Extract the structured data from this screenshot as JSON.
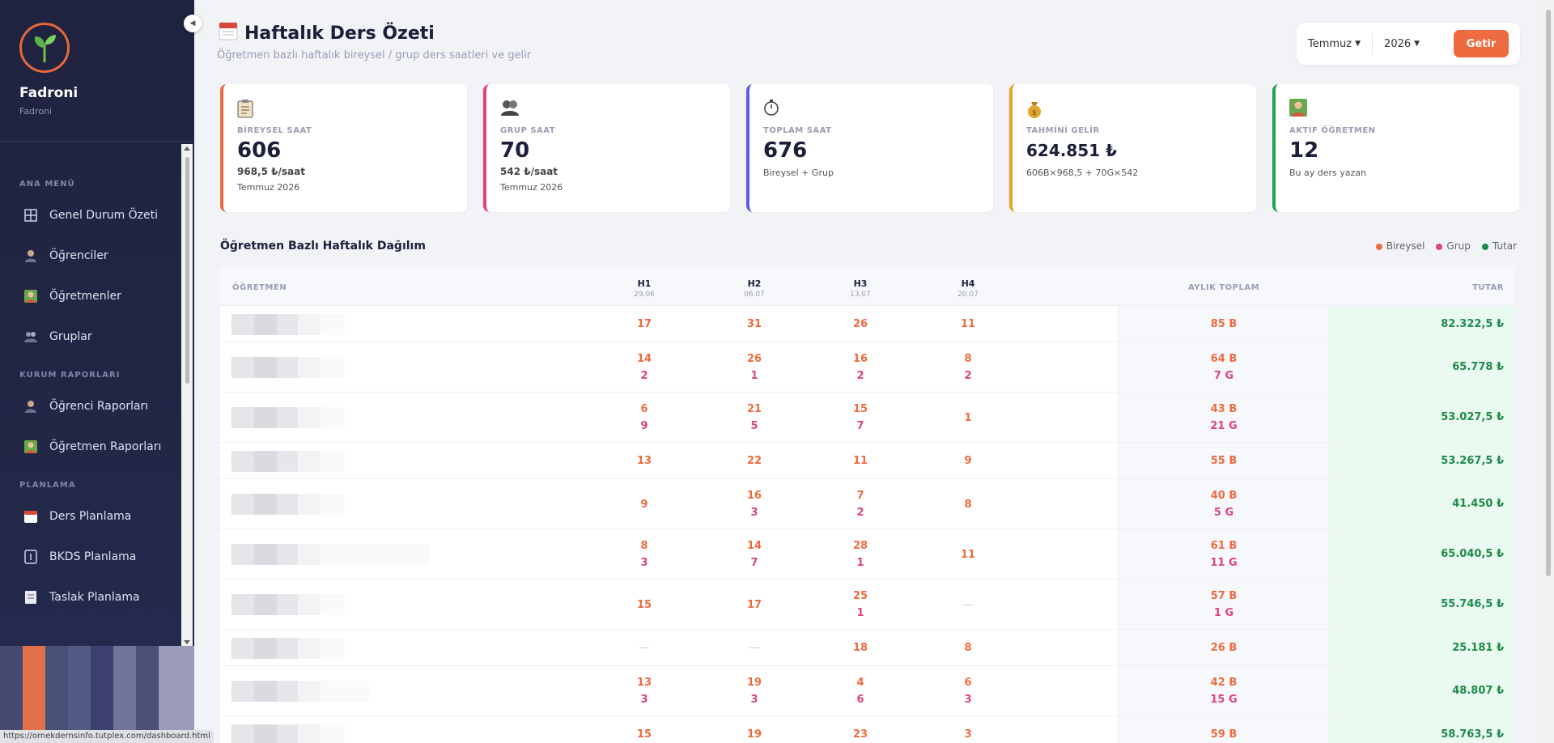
{
  "sidebar": {
    "brand": "Fadroni",
    "brand_sub": "Fadroni",
    "sections": [
      {
        "title": "ANA MENÜ"
      },
      {
        "title": "KURUM RAPORLARI"
      },
      {
        "title": "PLANLAMA"
      }
    ],
    "items": [
      {
        "label": "Genel Durum Özeti",
        "icon": "grid-icon"
      },
      {
        "label": "Öğrenciler",
        "icon": "student-icon"
      },
      {
        "label": "Öğretmenler",
        "icon": "teacher-icon"
      },
      {
        "label": "Gruplar",
        "icon": "group-icon"
      },
      {
        "label": "Öğrenci Raporları",
        "icon": "student-report-icon"
      },
      {
        "label": "Öğretmen Raporları",
        "icon": "teacher-report-icon"
      },
      {
        "label": "Ders Planlama",
        "icon": "calendar-icon"
      },
      {
        "label": "BKDS Planlama",
        "icon": "badge-icon"
      },
      {
        "label": "Taslak Planlama",
        "icon": "draft-icon"
      }
    ]
  },
  "status_url": "https://ornekdernsinfo.tutplex.com/dashboard.html",
  "header": {
    "title": "Haftalık Ders Özeti",
    "subtitle": "Öğretmen bazlı haftalık bireysel / grup ders saatleri ve gelir"
  },
  "filter": {
    "month": "Temmuz",
    "year": "2026",
    "button": "Getir"
  },
  "cards": [
    {
      "label": "BİREYSEL SAAT",
      "value": "606",
      "line1": "968,5 ₺/saat",
      "line2": "Temmuz 2026",
      "color": "#ee6b3f"
    },
    {
      "label": "GRUP SAAT",
      "value": "70",
      "line1": "542 ₺/saat",
      "line2": "Temmuz 2026",
      "color": "#e0427e"
    },
    {
      "label": "TOPLAM SAAT",
      "value": "676",
      "line1": "",
      "line2": "Bireysel + Grup",
      "color": "#5a5ee0"
    },
    {
      "label": "TAHMİNİ GELİR",
      "value": "624.851 ₺",
      "line1": "",
      "line2": "606B×968,5 + 70G×542",
      "color": "#f0a020"
    },
    {
      "label": "AKTİF ÖĞRETMEN",
      "value": "12",
      "line1": "",
      "line2": "Bu ay ders yazan",
      "color": "#22a35a"
    }
  ],
  "section_title": "Öğretmen Bazlı Haftalık Dağılım",
  "legend": [
    {
      "label": "Bireysel",
      "color": "#ee6b3f"
    },
    {
      "label": "Grup",
      "color": "#e0427e"
    },
    {
      "label": "Tutar",
      "color": "#1e8a4c"
    }
  ],
  "table": {
    "col_teacher": "ÖĞRETMEN",
    "weeks": [
      {
        "label": "H1",
        "date": "29.06"
      },
      {
        "label": "H2",
        "date": "06.07"
      },
      {
        "label": "H3",
        "date": "13.07"
      },
      {
        "label": "H4",
        "date": "20.07"
      }
    ],
    "col_month": "AYLIK TOPLAM",
    "col_amount": "TUTAR",
    "rows": [
      {
        "w": [
          [
            "17",
            ""
          ],
          [
            "31",
            ""
          ],
          [
            "26",
            ""
          ],
          [
            "11",
            ""
          ]
        ],
        "tb": "85 B",
        "tg": "",
        "amount": "82.322,5 ₺"
      },
      {
        "w": [
          [
            "14",
            "2"
          ],
          [
            "26",
            "1"
          ],
          [
            "16",
            "2"
          ],
          [
            "8",
            "2"
          ]
        ],
        "tb": "64 B",
        "tg": "7 G",
        "amount": "65.778 ₺"
      },
      {
        "w": [
          [
            "6",
            "9"
          ],
          [
            "21",
            "5"
          ],
          [
            "15",
            "7"
          ],
          [
            "",
            "1"
          ]
        ],
        "tb": "43 B",
        "tg": "21 G",
        "amount": "53.027,5 ₺"
      },
      {
        "w": [
          [
            "13",
            ""
          ],
          [
            "22",
            ""
          ],
          [
            "11",
            ""
          ],
          [
            "9",
            ""
          ]
        ],
        "tb": "55 B",
        "tg": "",
        "amount": "53.267,5 ₺"
      },
      {
        "w": [
          [
            "9",
            ""
          ],
          [
            "16",
            "3"
          ],
          [
            "7",
            "2"
          ],
          [
            "8",
            ""
          ]
        ],
        "tb": "40 B",
        "tg": "5 G",
        "amount": "41.450 ₺"
      },
      {
        "w": [
          [
            "8",
            "3"
          ],
          [
            "14",
            "7"
          ],
          [
            "28",
            "1"
          ],
          [
            "",
            "11"
          ]
        ],
        "tb": "61 B",
        "tg": "11 G",
        "amount": "65.040,5 ₺"
      },
      {
        "w": [
          [
            "15",
            ""
          ],
          [
            "17",
            ""
          ],
          [
            "25",
            "1"
          ],
          [
            "—",
            ""
          ]
        ],
        "tb": "57 B",
        "tg": "1 G",
        "amount": "55.746,5 ₺"
      },
      {
        "w": [
          [
            "—",
            ""
          ],
          [
            "—",
            ""
          ],
          [
            "18",
            ""
          ],
          [
            "8",
            ""
          ]
        ],
        "tb": "26 B",
        "tg": "",
        "amount": "25.181 ₺"
      },
      {
        "w": [
          [
            "13",
            "3"
          ],
          [
            "19",
            "3"
          ],
          [
            "4",
            "6"
          ],
          [
            "6",
            "3"
          ]
        ],
        "tb": "42 B",
        "tg": "15 G",
        "amount": "48.807 ₺"
      },
      {
        "w": [
          [
            "15",
            ""
          ],
          [
            "19",
            ""
          ],
          [
            "23",
            ""
          ],
          [
            "3",
            ""
          ]
        ],
        "tb": "59 B",
        "tg": "",
        "amount": "58.763,5 ₺"
      }
    ]
  }
}
